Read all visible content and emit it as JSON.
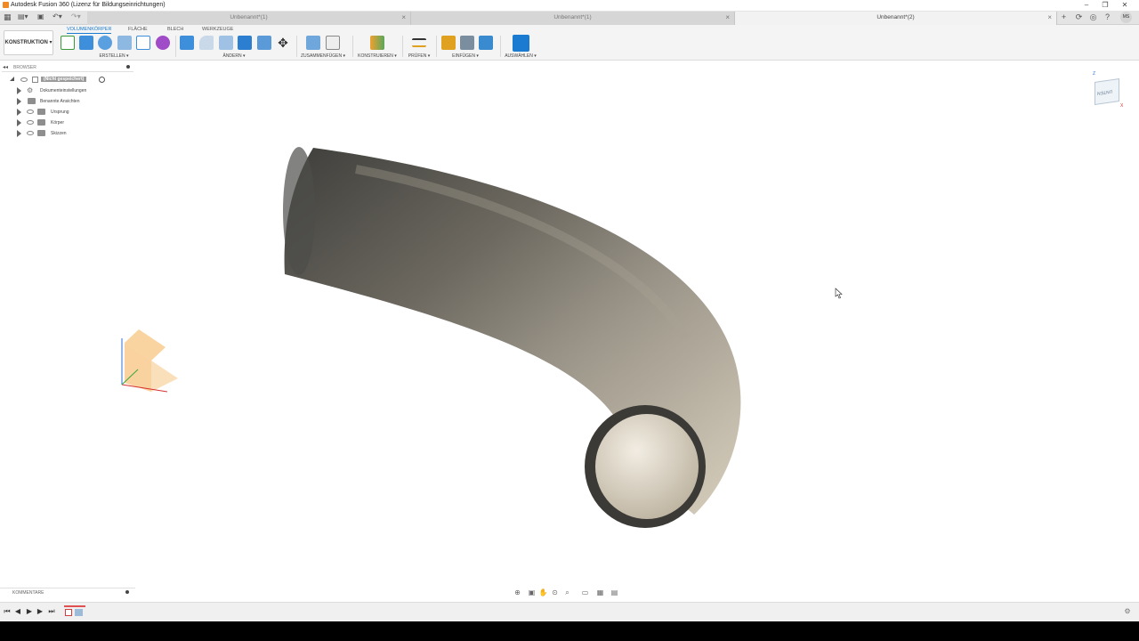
{
  "window": {
    "title": "Autodesk Fusion 360 (Lizenz für Bildungseinrichtungen)"
  },
  "tabs": [
    {
      "label": "Unbenannt*(1)",
      "active": false
    },
    {
      "label": "Unbenannt*(1)",
      "active": false
    },
    {
      "label": "Unbenannt*(2)",
      "active": true
    }
  ],
  "user_initials": "MS",
  "toolbar": {
    "workspace": "KONSTRUKTION ▾",
    "ribbon_tabs": [
      "VOLUMENKÖRPER",
      "FLÄCHE",
      "BLECH",
      "WERKZEUGE"
    ],
    "groups": {
      "create": "ERSTELLEN ▾",
      "modify": "ÄNDERN ▾",
      "assemble": "ZUSAMMENFÜGEN ▾",
      "construct": "KONSTRUIEREN ▾",
      "inspect": "PRÜFEN ▾",
      "insert": "EINFÜGEN ▾",
      "select": "AUSWÄHLEN ▾"
    }
  },
  "browser": {
    "title": "BROWSER",
    "root": "(Nicht gespeichert)",
    "items": [
      "Dokumenteinstellungen",
      "Benannte Ansichten",
      "Ursprung",
      "Körper",
      "Skizzen"
    ]
  },
  "viewcube": {
    "face": "UNTEN",
    "axis_z": "Z",
    "axis_x": "X"
  },
  "comments": {
    "title": "KOMMENTARE"
  },
  "colors": {
    "accent": "#1a7bd0",
    "pipe_dark": "#3a3a38",
    "pipe_light": "#cfc6b4",
    "origin": "#f5a623"
  },
  "icons": {
    "window": [
      "minimize-icon",
      "restore-icon",
      "close-icon"
    ],
    "tabbar": [
      "new-tab-icon",
      "job-status-icon",
      "notifications-icon",
      "help-icon"
    ],
    "nav": [
      "orbit-icon",
      "look-at-icon",
      "pan-icon",
      "zoom-window-icon",
      "fit-icon",
      "display-settings-icon",
      "grid-settings-icon",
      "viewports-icon"
    ],
    "timeline": [
      "first-icon",
      "prev-icon",
      "play-icon",
      "next-icon",
      "last-icon",
      "settings-gear-icon"
    ]
  }
}
